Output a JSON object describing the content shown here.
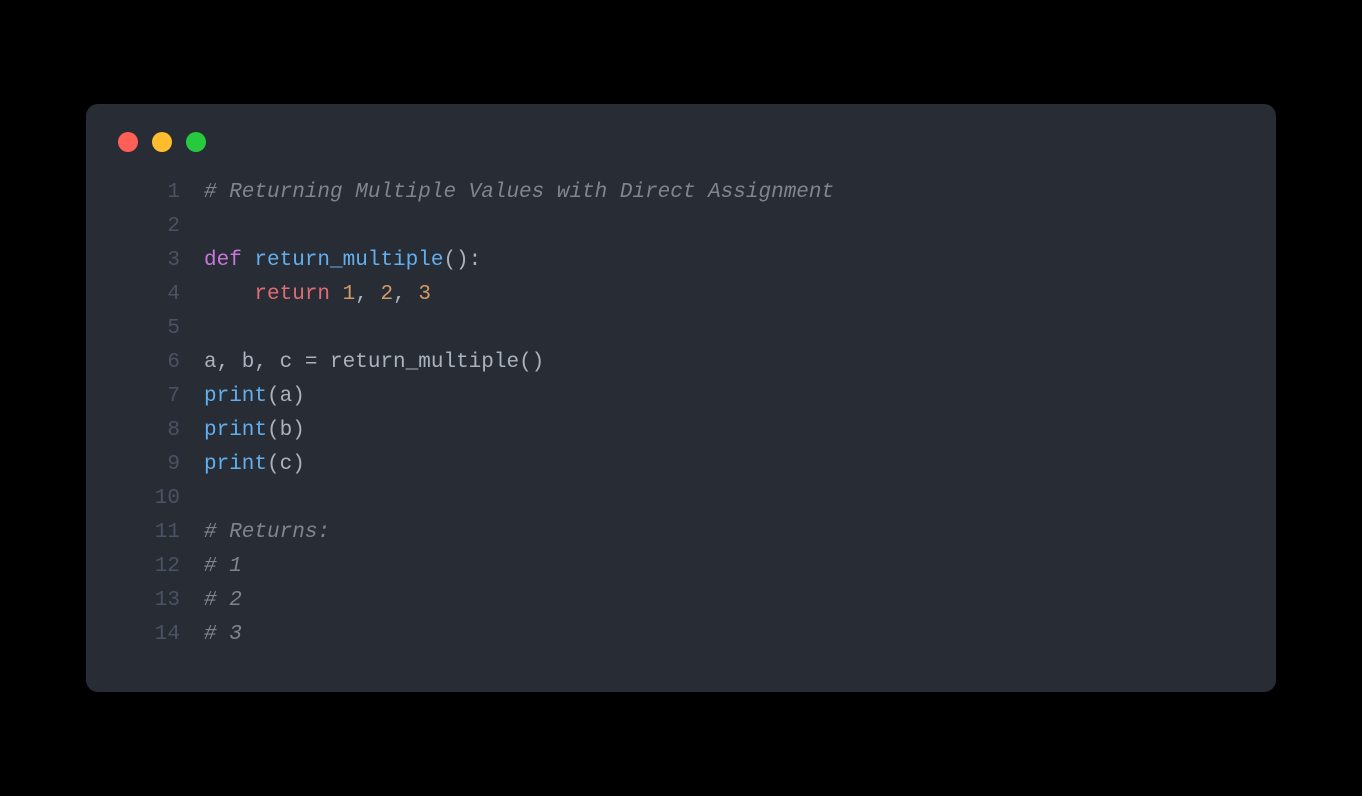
{
  "window": {
    "traffic_lights": {
      "red": "#ff5f56",
      "yellow": "#ffbd2e",
      "green": "#27c93f"
    }
  },
  "code": {
    "language": "python",
    "line_numbers": [
      "1",
      "2",
      "3",
      "4",
      "5",
      "6",
      "7",
      "8",
      "9",
      "10",
      "11",
      "12",
      "13",
      "14"
    ],
    "lines": [
      [
        {
          "t": "comment",
          "v": "# Returning Multiple Values with Direct Assignment"
        }
      ],
      [],
      [
        {
          "t": "keyword",
          "v": "def"
        },
        {
          "t": "plain",
          "v": " "
        },
        {
          "t": "def",
          "v": "return_multiple"
        },
        {
          "t": "punct",
          "v": "():"
        }
      ],
      [
        {
          "t": "plain",
          "v": "    "
        },
        {
          "t": "return",
          "v": "return"
        },
        {
          "t": "plain",
          "v": " "
        },
        {
          "t": "number",
          "v": "1"
        },
        {
          "t": "punct",
          "v": ", "
        },
        {
          "t": "number",
          "v": "2"
        },
        {
          "t": "punct",
          "v": ", "
        },
        {
          "t": "number",
          "v": "3"
        }
      ],
      [],
      [
        {
          "t": "ident",
          "v": "a, b, c "
        },
        {
          "t": "punct",
          "v": "= "
        },
        {
          "t": "ident",
          "v": "return_multiple()"
        }
      ],
      [
        {
          "t": "call",
          "v": "print"
        },
        {
          "t": "punct",
          "v": "("
        },
        {
          "t": "ident",
          "v": "a"
        },
        {
          "t": "punct",
          "v": ")"
        }
      ],
      [
        {
          "t": "call",
          "v": "print"
        },
        {
          "t": "punct",
          "v": "("
        },
        {
          "t": "ident",
          "v": "b"
        },
        {
          "t": "punct",
          "v": ")"
        }
      ],
      [
        {
          "t": "call",
          "v": "print"
        },
        {
          "t": "punct",
          "v": "("
        },
        {
          "t": "ident",
          "v": "c"
        },
        {
          "t": "punct",
          "v": ")"
        }
      ],
      [],
      [
        {
          "t": "comment",
          "v": "# Returns:"
        }
      ],
      [
        {
          "t": "comment",
          "v": "# 1"
        }
      ],
      [
        {
          "t": "comment",
          "v": "# 2"
        }
      ],
      [
        {
          "t": "comment",
          "v": "# 3"
        }
      ]
    ]
  }
}
